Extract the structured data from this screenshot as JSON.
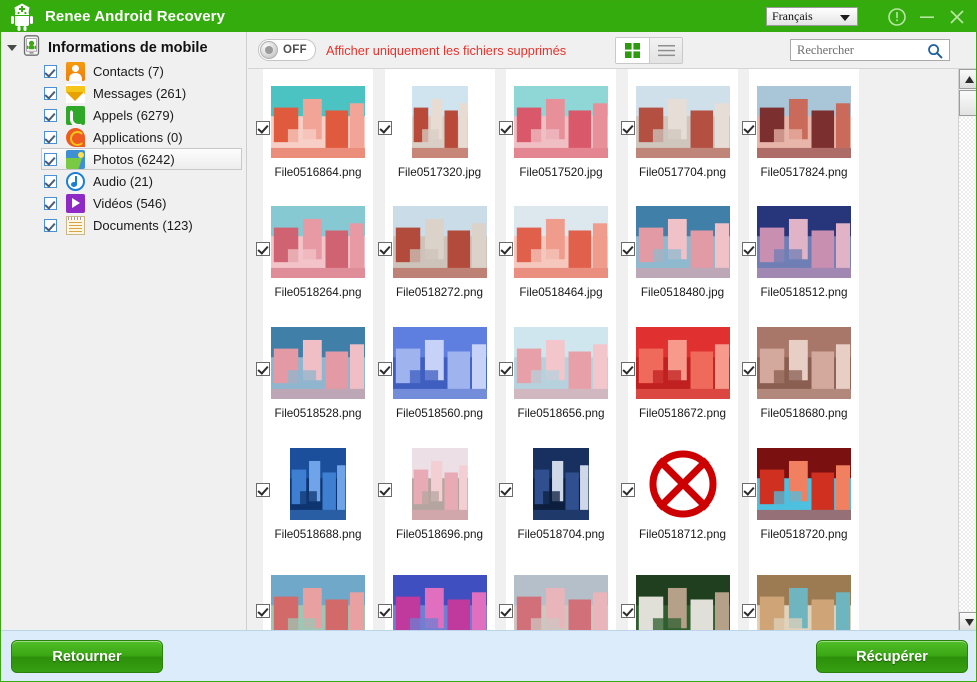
{
  "window": {
    "app_title": "Renee Android Recovery",
    "logo_icon": "android-medic-logo",
    "language": "Français",
    "language_caret_icon": "chevron-down-icon",
    "info_icon": "info-circle-icon",
    "minimize_icon": "minimize-icon",
    "close_icon": "close-icon",
    "title_bg": "#34ac0d"
  },
  "sidebar": {
    "root": {
      "label": "Informations de mobile",
      "icon": "mobile-phone-icon",
      "expander_icon": "triangle-down-icon"
    },
    "items": [
      {
        "label": "Contacts (7)",
        "icon": "contacts-icon",
        "checked": true,
        "selected": false,
        "icon_class": "ico-contacts"
      },
      {
        "label": "Messages (261)",
        "icon": "messages-icon",
        "checked": true,
        "selected": false,
        "icon_class": "ico-messages"
      },
      {
        "label": "Appels (6279)",
        "icon": "calls-icon",
        "checked": true,
        "selected": false,
        "icon_class": "ico-calls"
      },
      {
        "label": "Applications (0)",
        "icon": "apps-icon",
        "checked": true,
        "selected": false,
        "icon_class": "ico-apps"
      },
      {
        "label": "Photos (6242)",
        "icon": "photos-icon",
        "checked": true,
        "selected": true,
        "icon_class": "ico-photos"
      },
      {
        "label": "Audio (21)",
        "icon": "audio-icon",
        "checked": true,
        "selected": false,
        "icon_class": "ico-audio"
      },
      {
        "label": "Vidéos (546)",
        "icon": "videos-icon",
        "checked": true,
        "selected": false,
        "icon_class": "ico-videos"
      },
      {
        "label": "Documents (123)",
        "icon": "documents-icon",
        "checked": true,
        "selected": false,
        "icon_class": "ico-docs"
      }
    ]
  },
  "toolbar": {
    "toggle_state": "OFF",
    "toggle_label": "Afficher uniquement les fichiers supprimés",
    "label_color": "#e8312a",
    "grid_view_icon": "grid-view-icon",
    "list_view_icon": "list-view-icon",
    "active_view": "grid",
    "search_placeholder": "Rechercher",
    "search_value": "",
    "search_icon": "search-icon"
  },
  "grid": {
    "checkbox_icon": "checkmark-icon",
    "items": [
      {
        "name": "File0516864.png",
        "checked": true,
        "broken": false,
        "thumb": "t1",
        "orient": "land"
      },
      {
        "name": "File0517320.jpg",
        "checked": true,
        "broken": false,
        "thumb": "t2",
        "orient": "port"
      },
      {
        "name": "File0517520.jpg",
        "checked": true,
        "broken": false,
        "thumb": "t3",
        "orient": "land"
      },
      {
        "name": "File0517704.png",
        "checked": true,
        "broken": false,
        "thumb": "t4",
        "orient": "land"
      },
      {
        "name": "File0517824.png",
        "checked": true,
        "broken": false,
        "thumb": "t5",
        "orient": "land"
      },
      {
        "name": "File0518264.png",
        "checked": true,
        "broken": false,
        "thumb": "t6",
        "orient": "land"
      },
      {
        "name": "File0518272.png",
        "checked": true,
        "broken": false,
        "thumb": "t7",
        "orient": "land"
      },
      {
        "name": "File0518464.jpg",
        "checked": true,
        "broken": false,
        "thumb": "t8",
        "orient": "land"
      },
      {
        "name": "File0518480.jpg",
        "checked": true,
        "broken": false,
        "thumb": "t9",
        "orient": "land"
      },
      {
        "name": "File0518512.png",
        "checked": true,
        "broken": false,
        "thumb": "t10",
        "orient": "land"
      },
      {
        "name": "File0518528.png",
        "checked": true,
        "broken": false,
        "thumb": "t11",
        "orient": "land"
      },
      {
        "name": "File0518560.png",
        "checked": true,
        "broken": false,
        "thumb": "t12",
        "orient": "land"
      },
      {
        "name": "File0518656.png",
        "checked": true,
        "broken": false,
        "thumb": "t13",
        "orient": "land"
      },
      {
        "name": "File0518672.png",
        "checked": true,
        "broken": false,
        "thumb": "t14",
        "orient": "land"
      },
      {
        "name": "File0518680.png",
        "checked": true,
        "broken": false,
        "thumb": "t15",
        "orient": "land"
      },
      {
        "name": "File0518688.png",
        "checked": true,
        "broken": false,
        "thumb": "t16",
        "orient": "port"
      },
      {
        "name": "File0518696.png",
        "checked": true,
        "broken": false,
        "thumb": "t17",
        "orient": "port"
      },
      {
        "name": "File0518704.png",
        "checked": true,
        "broken": false,
        "thumb": "t18",
        "orient": "port"
      },
      {
        "name": "File0518712.png",
        "checked": true,
        "broken": true,
        "thumb": "",
        "orient": "land"
      },
      {
        "name": "File0518720.png",
        "checked": true,
        "broken": false,
        "thumb": "t19",
        "orient": "land"
      },
      {
        "name": "",
        "checked": true,
        "broken": false,
        "thumb": "t20",
        "orient": "land"
      },
      {
        "name": "",
        "checked": true,
        "broken": false,
        "thumb": "t21",
        "orient": "land"
      },
      {
        "name": "",
        "checked": true,
        "broken": false,
        "thumb": "t22",
        "orient": "land"
      },
      {
        "name": "",
        "checked": true,
        "broken": false,
        "thumb": "t23",
        "orient": "land"
      },
      {
        "name": "",
        "checked": true,
        "broken": false,
        "thumb": "t24",
        "orient": "land"
      }
    ]
  },
  "scrollbar": {
    "up_icon": "triangle-up-icon",
    "down_icon": "triangle-down-icon"
  },
  "footer": {
    "back_label": "Retourner",
    "recover_label": "Récupérer",
    "button_color": "#3aa614",
    "bg": "#dcecfb"
  }
}
